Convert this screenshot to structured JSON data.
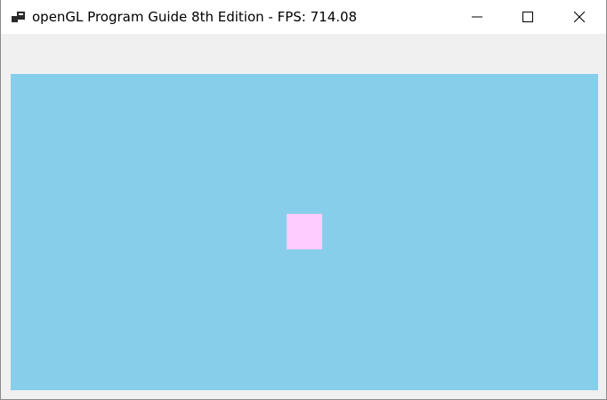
{
  "window": {
    "title": "openGL Program Guide 8th Edition - FPS: 714.08",
    "app_icon": "app-window-icon"
  },
  "caption_buttons": {
    "minimize_icon": "minimize-icon",
    "maximize_icon": "maximize-icon",
    "close_icon": "close-icon"
  },
  "render": {
    "clear_color": "#87ceeb",
    "quad_color": "#ffccff"
  }
}
